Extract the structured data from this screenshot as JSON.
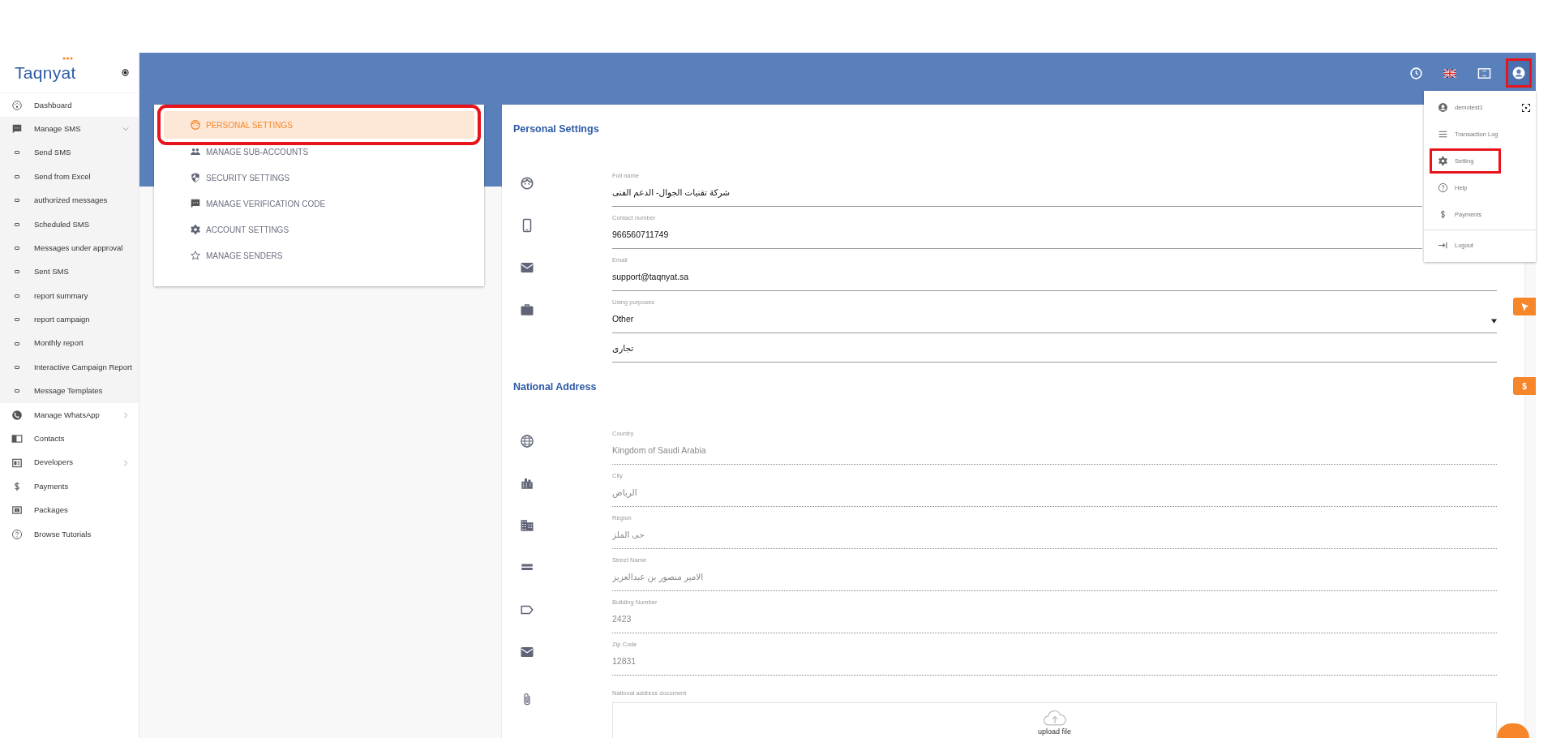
{
  "logo": {
    "text": "Taqnyat"
  },
  "sidebar": {
    "items": [
      {
        "label": "Dashboard"
      },
      {
        "label": "Manage SMS",
        "expanded": true,
        "children": [
          {
            "label": "Send SMS"
          },
          {
            "label": "Send from Excel"
          },
          {
            "label": "authorized messages"
          },
          {
            "label": "Scheduled SMS"
          },
          {
            "label": "Messages under approval"
          },
          {
            "label": "Sent SMS"
          },
          {
            "label": "report summary"
          },
          {
            "label": "report campaign"
          },
          {
            "label": "Monthly report"
          },
          {
            "label": "Interactive Campaign Report"
          },
          {
            "label": "Message Templates"
          }
        ]
      },
      {
        "label": "Manage WhatsApp",
        "expanded": false
      },
      {
        "label": "Contacts"
      },
      {
        "label": "Developers",
        "expanded": false
      },
      {
        "label": "Payments"
      },
      {
        "label": "Packages"
      },
      {
        "label": "Browse Tutorials"
      }
    ]
  },
  "topbar": {
    "account_highlighted": true
  },
  "user_menu": {
    "username": "demotest1",
    "items": [
      {
        "label": "Transaction Log",
        "highlighted": false
      },
      {
        "label": "Setting",
        "highlighted": true
      },
      {
        "label": "Help",
        "highlighted": false
      },
      {
        "label": "Payments",
        "highlighted": false
      },
      {
        "label": "Logout",
        "highlighted": false
      }
    ]
  },
  "settings_menu": {
    "items": [
      {
        "label": "PERSONAL SETTINGS",
        "selected": true,
        "highlighted": true
      },
      {
        "label": "MANAGE SUB-ACCOUNTS",
        "selected": false,
        "highlighted": false
      },
      {
        "label": "SECURITY SETTINGS",
        "selected": false,
        "highlighted": false
      },
      {
        "label": "MANAGE VERIFICATION CODE",
        "selected": false,
        "highlighted": false
      },
      {
        "label": "ACCOUNT SETTINGS",
        "selected": false,
        "highlighted": false
      },
      {
        "label": "MANAGE SENDERS",
        "selected": false,
        "highlighted": false
      }
    ]
  },
  "personal_settings": {
    "title": "Personal Settings",
    "fields": [
      {
        "kind": "text",
        "label": "Full name",
        "value": "شركة تقنيات الجوال- الدعم الفنى",
        "disabled": false
      },
      {
        "kind": "text",
        "label": "Contact number",
        "value": "966560711749",
        "disabled": false
      },
      {
        "kind": "text",
        "label": "Email",
        "value": "support@taqnyat.sa",
        "disabled": false
      },
      {
        "kind": "select",
        "label": "Using purposes",
        "value": "Other",
        "disabled": false
      },
      {
        "kind": "plain",
        "value": "تجارى",
        "disabled": false
      }
    ]
  },
  "national_address": {
    "title": "National Address",
    "fields": [
      {
        "label": "Country",
        "value": "Kingdom of Saudi Arabia",
        "disabled": true
      },
      {
        "label": "City",
        "value": "الرياض",
        "disabled": true
      },
      {
        "label": "Region",
        "value": "حى الملز",
        "disabled": true
      },
      {
        "label": "Street Name",
        "value": "الامير منصور بن عبدالعزيز",
        "disabled": true
      },
      {
        "label": "Building Number",
        "value": "2423",
        "disabled": true
      },
      {
        "label": "Zip Code",
        "value": "12831",
        "disabled": true
      }
    ],
    "document": {
      "label": "National address document",
      "upload_text": "upload file"
    }
  },
  "side_tabs": [
    {
      "kind": "send"
    },
    {
      "kind": "dollar",
      "text": "$"
    }
  ]
}
